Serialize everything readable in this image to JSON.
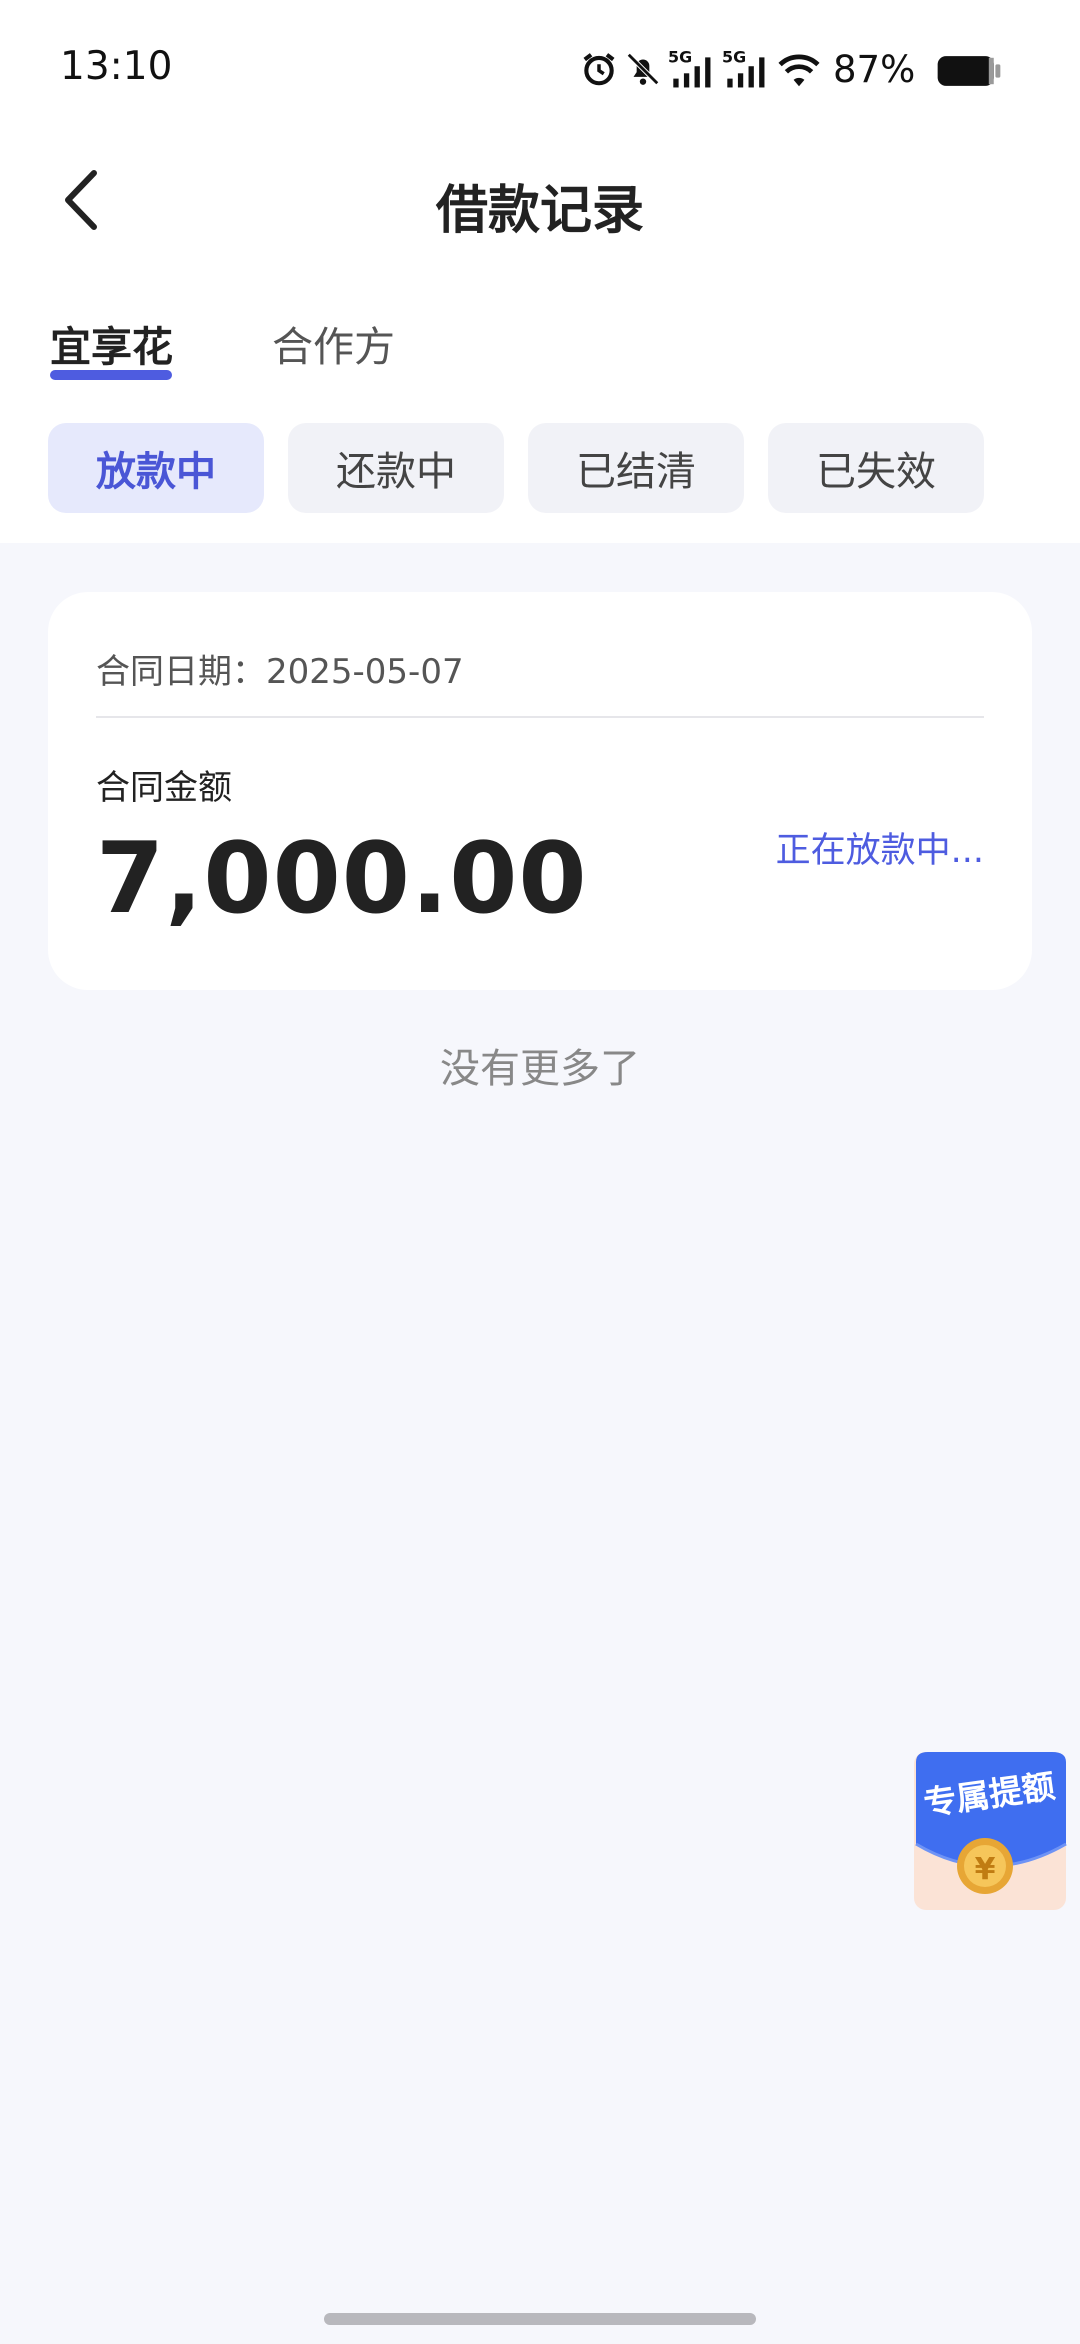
{
  "status_bar": {
    "time": "13:10",
    "battery_text": "87%",
    "icons": [
      "alarm-icon",
      "bell-muted-icon",
      "signal-5g-icon",
      "signal-5g-icon",
      "wifi-icon",
      "battery-icon"
    ]
  },
  "header": {
    "title": "借款记录",
    "back_icon": "chevron-left-icon"
  },
  "tabs": [
    {
      "label": "宜享花",
      "active": true
    },
    {
      "label": "合作方",
      "active": false
    }
  ],
  "filters": [
    {
      "label": "放款中",
      "active": true
    },
    {
      "label": "还款中",
      "active": false
    },
    {
      "label": "已结清",
      "active": false
    },
    {
      "label": "已失效",
      "active": false
    }
  ],
  "records": [
    {
      "contract_date": "合同日期：2025-05-07",
      "amount_label": "合同金额",
      "amount": "7,000.00",
      "status": "正在放款中..."
    }
  ],
  "footer": {
    "no_more": "没有更多了"
  },
  "promo": {
    "label": "专属提额",
    "coin_symbol": "¥"
  },
  "colors": {
    "accent": "#4e5ce0",
    "background": "#f6f7fc",
    "chip_active_bg": "#e6e9fc"
  }
}
